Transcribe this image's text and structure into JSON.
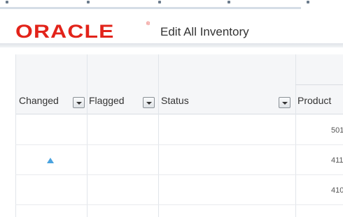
{
  "brand": {
    "logo_text": "ORACLE",
    "logo_mark": "®",
    "color": "#e2231a"
  },
  "page": {
    "title": "Edit All Inventory"
  },
  "table": {
    "columns": [
      {
        "label": "Changed",
        "has_filter": true
      },
      {
        "label": "Flagged",
        "has_filter": true
      },
      {
        "label": "Status",
        "has_filter": true
      },
      {
        "label": "Product",
        "has_filter": false
      }
    ],
    "rows": [
      {
        "changed": "",
        "product": "501"
      },
      {
        "changed": "triangle-up-icon",
        "product": "411"
      },
      {
        "changed": "",
        "product": "410"
      }
    ]
  },
  "colors": {
    "accent": "#4aa3df",
    "header_bg": "#f5f6f8",
    "grid_line": "#e1e5ea"
  }
}
